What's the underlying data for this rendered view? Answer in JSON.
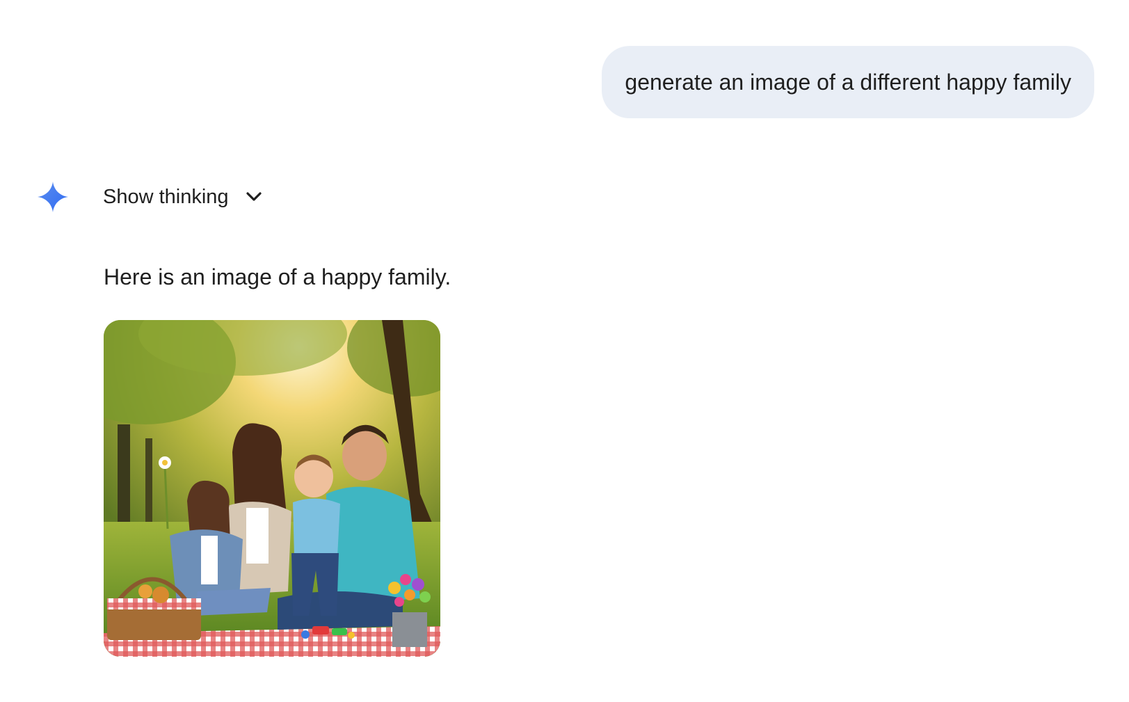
{
  "conversation": {
    "user_message": "generate an image of a different happy family",
    "assistant": {
      "thinking_toggle_label": "Show thinking",
      "response_text": "Here is an image of a happy family.",
      "image": {
        "alt": "happy family"
      }
    }
  },
  "icons": {
    "assistant_avatar": "gemini-spark-icon",
    "thinking_toggle": "chevron-down-icon"
  },
  "colors": {
    "user_bubble_bg": "#e9eef6",
    "text": "#1f1f1f",
    "spark_blue": "#4285f4"
  }
}
